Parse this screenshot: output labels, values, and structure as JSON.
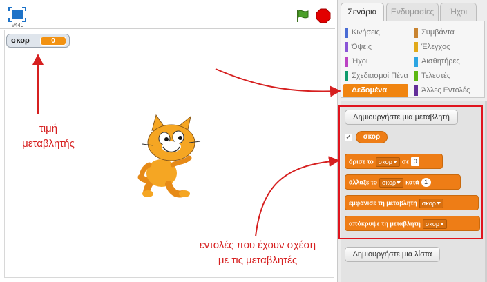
{
  "stage": {
    "version": "v440",
    "monitor": {
      "name": "σκορ",
      "value": "0"
    }
  },
  "annotations": {
    "variable_value": [
      "τιμή",
      "μεταβλητής"
    ],
    "variable_commands": [
      "εντολές που έχουν σχέση",
      "με τις μεταβλητές"
    ],
    "color": "#d62020"
  },
  "palette": {
    "tabs": [
      "Σενάρια",
      "Ενδυμασίες",
      "Ήχοι"
    ],
    "active_tab": "Σενάρια",
    "categories": [
      {
        "label": "Κινήσεις",
        "color": "#4a6cd4"
      },
      {
        "label": "Όψεις",
        "color": "#8a55d7"
      },
      {
        "label": "Ήχοι",
        "color": "#bb42c3"
      },
      {
        "label": "Σχεδιασμοί Πένα",
        "color": "#0e9a6c"
      },
      {
        "label": "Δεδομένα",
        "color": "#ee7d16"
      },
      {
        "label": "Συμβάντα",
        "color": "#c88330"
      },
      {
        "label": "Έλεγχος",
        "color": "#e1a91a"
      },
      {
        "label": "Αισθητήρες",
        "color": "#2ca5e2"
      },
      {
        "label": "Τελεστές",
        "color": "#5cb712"
      },
      {
        "label": "Άλλες Εντολές",
        "color": "#632d99"
      }
    ],
    "active_category": "Δεδομένα",
    "make_variable": "Δημιουργήστε μια μεταβλητή",
    "variable_reporter": "σκορ",
    "variable_checked": true,
    "blocks": {
      "set": {
        "text": "όρισε το",
        "var": "σκορ",
        "mid": "σε",
        "value": "0"
      },
      "change": {
        "text": "άλλαξε το",
        "var": "σκορ",
        "mid": "κατά",
        "value": "1"
      },
      "show": {
        "text": "εμφάνισε τη μεταβλητή",
        "var": "σκορ"
      },
      "hide": {
        "text": "απόκρυψε τη μεταβλητή",
        "var": "σκορ"
      }
    },
    "make_list": "Δημιουργήστε μια λίστα"
  }
}
